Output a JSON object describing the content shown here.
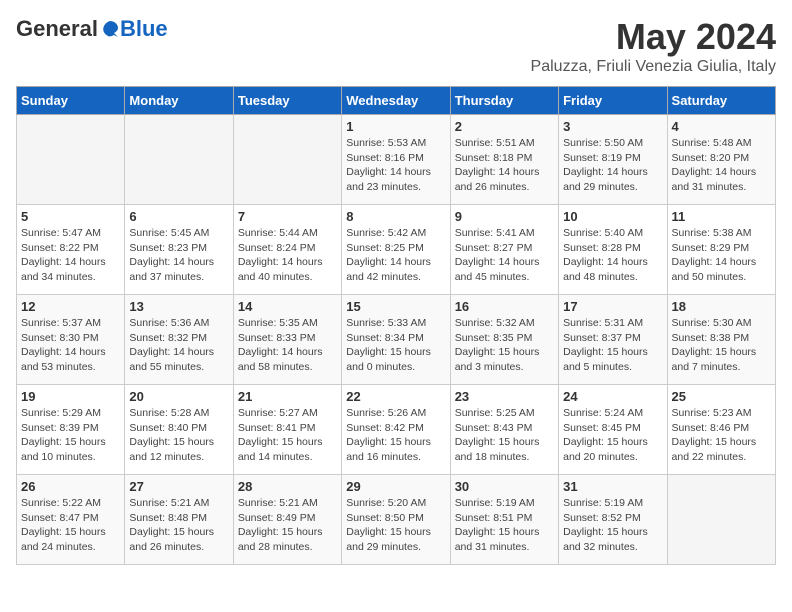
{
  "logo": {
    "general": "General",
    "blue": "Blue"
  },
  "title": {
    "month": "May 2024",
    "location": "Paluzza, Friuli Venezia Giulia, Italy"
  },
  "days_of_week": [
    "Sunday",
    "Monday",
    "Tuesday",
    "Wednesday",
    "Thursday",
    "Friday",
    "Saturday"
  ],
  "weeks": [
    [
      {
        "day": "",
        "info": ""
      },
      {
        "day": "",
        "info": ""
      },
      {
        "day": "",
        "info": ""
      },
      {
        "day": "1",
        "info": "Sunrise: 5:53 AM\nSunset: 8:16 PM\nDaylight: 14 hours\nand 23 minutes."
      },
      {
        "day": "2",
        "info": "Sunrise: 5:51 AM\nSunset: 8:18 PM\nDaylight: 14 hours\nand 26 minutes."
      },
      {
        "day": "3",
        "info": "Sunrise: 5:50 AM\nSunset: 8:19 PM\nDaylight: 14 hours\nand 29 minutes."
      },
      {
        "day": "4",
        "info": "Sunrise: 5:48 AM\nSunset: 8:20 PM\nDaylight: 14 hours\nand 31 minutes."
      }
    ],
    [
      {
        "day": "5",
        "info": "Sunrise: 5:47 AM\nSunset: 8:22 PM\nDaylight: 14 hours\nand 34 minutes."
      },
      {
        "day": "6",
        "info": "Sunrise: 5:45 AM\nSunset: 8:23 PM\nDaylight: 14 hours\nand 37 minutes."
      },
      {
        "day": "7",
        "info": "Sunrise: 5:44 AM\nSunset: 8:24 PM\nDaylight: 14 hours\nand 40 minutes."
      },
      {
        "day": "8",
        "info": "Sunrise: 5:42 AM\nSunset: 8:25 PM\nDaylight: 14 hours\nand 42 minutes."
      },
      {
        "day": "9",
        "info": "Sunrise: 5:41 AM\nSunset: 8:27 PM\nDaylight: 14 hours\nand 45 minutes."
      },
      {
        "day": "10",
        "info": "Sunrise: 5:40 AM\nSunset: 8:28 PM\nDaylight: 14 hours\nand 48 minutes."
      },
      {
        "day": "11",
        "info": "Sunrise: 5:38 AM\nSunset: 8:29 PM\nDaylight: 14 hours\nand 50 minutes."
      }
    ],
    [
      {
        "day": "12",
        "info": "Sunrise: 5:37 AM\nSunset: 8:30 PM\nDaylight: 14 hours\nand 53 minutes."
      },
      {
        "day": "13",
        "info": "Sunrise: 5:36 AM\nSunset: 8:32 PM\nDaylight: 14 hours\nand 55 minutes."
      },
      {
        "day": "14",
        "info": "Sunrise: 5:35 AM\nSunset: 8:33 PM\nDaylight: 14 hours\nand 58 minutes."
      },
      {
        "day": "15",
        "info": "Sunrise: 5:33 AM\nSunset: 8:34 PM\nDaylight: 15 hours\nand 0 minutes."
      },
      {
        "day": "16",
        "info": "Sunrise: 5:32 AM\nSunset: 8:35 PM\nDaylight: 15 hours\nand 3 minutes."
      },
      {
        "day": "17",
        "info": "Sunrise: 5:31 AM\nSunset: 8:37 PM\nDaylight: 15 hours\nand 5 minutes."
      },
      {
        "day": "18",
        "info": "Sunrise: 5:30 AM\nSunset: 8:38 PM\nDaylight: 15 hours\nand 7 minutes."
      }
    ],
    [
      {
        "day": "19",
        "info": "Sunrise: 5:29 AM\nSunset: 8:39 PM\nDaylight: 15 hours\nand 10 minutes."
      },
      {
        "day": "20",
        "info": "Sunrise: 5:28 AM\nSunset: 8:40 PM\nDaylight: 15 hours\nand 12 minutes."
      },
      {
        "day": "21",
        "info": "Sunrise: 5:27 AM\nSunset: 8:41 PM\nDaylight: 15 hours\nand 14 minutes."
      },
      {
        "day": "22",
        "info": "Sunrise: 5:26 AM\nSunset: 8:42 PM\nDaylight: 15 hours\nand 16 minutes."
      },
      {
        "day": "23",
        "info": "Sunrise: 5:25 AM\nSunset: 8:43 PM\nDaylight: 15 hours\nand 18 minutes."
      },
      {
        "day": "24",
        "info": "Sunrise: 5:24 AM\nSunset: 8:45 PM\nDaylight: 15 hours\nand 20 minutes."
      },
      {
        "day": "25",
        "info": "Sunrise: 5:23 AM\nSunset: 8:46 PM\nDaylight: 15 hours\nand 22 minutes."
      }
    ],
    [
      {
        "day": "26",
        "info": "Sunrise: 5:22 AM\nSunset: 8:47 PM\nDaylight: 15 hours\nand 24 minutes."
      },
      {
        "day": "27",
        "info": "Sunrise: 5:21 AM\nSunset: 8:48 PM\nDaylight: 15 hours\nand 26 minutes."
      },
      {
        "day": "28",
        "info": "Sunrise: 5:21 AM\nSunset: 8:49 PM\nDaylight: 15 hours\nand 28 minutes."
      },
      {
        "day": "29",
        "info": "Sunrise: 5:20 AM\nSunset: 8:50 PM\nDaylight: 15 hours\nand 29 minutes."
      },
      {
        "day": "30",
        "info": "Sunrise: 5:19 AM\nSunset: 8:51 PM\nDaylight: 15 hours\nand 31 minutes."
      },
      {
        "day": "31",
        "info": "Sunrise: 5:19 AM\nSunset: 8:52 PM\nDaylight: 15 hours\nand 32 minutes."
      },
      {
        "day": "",
        "info": ""
      }
    ]
  ]
}
